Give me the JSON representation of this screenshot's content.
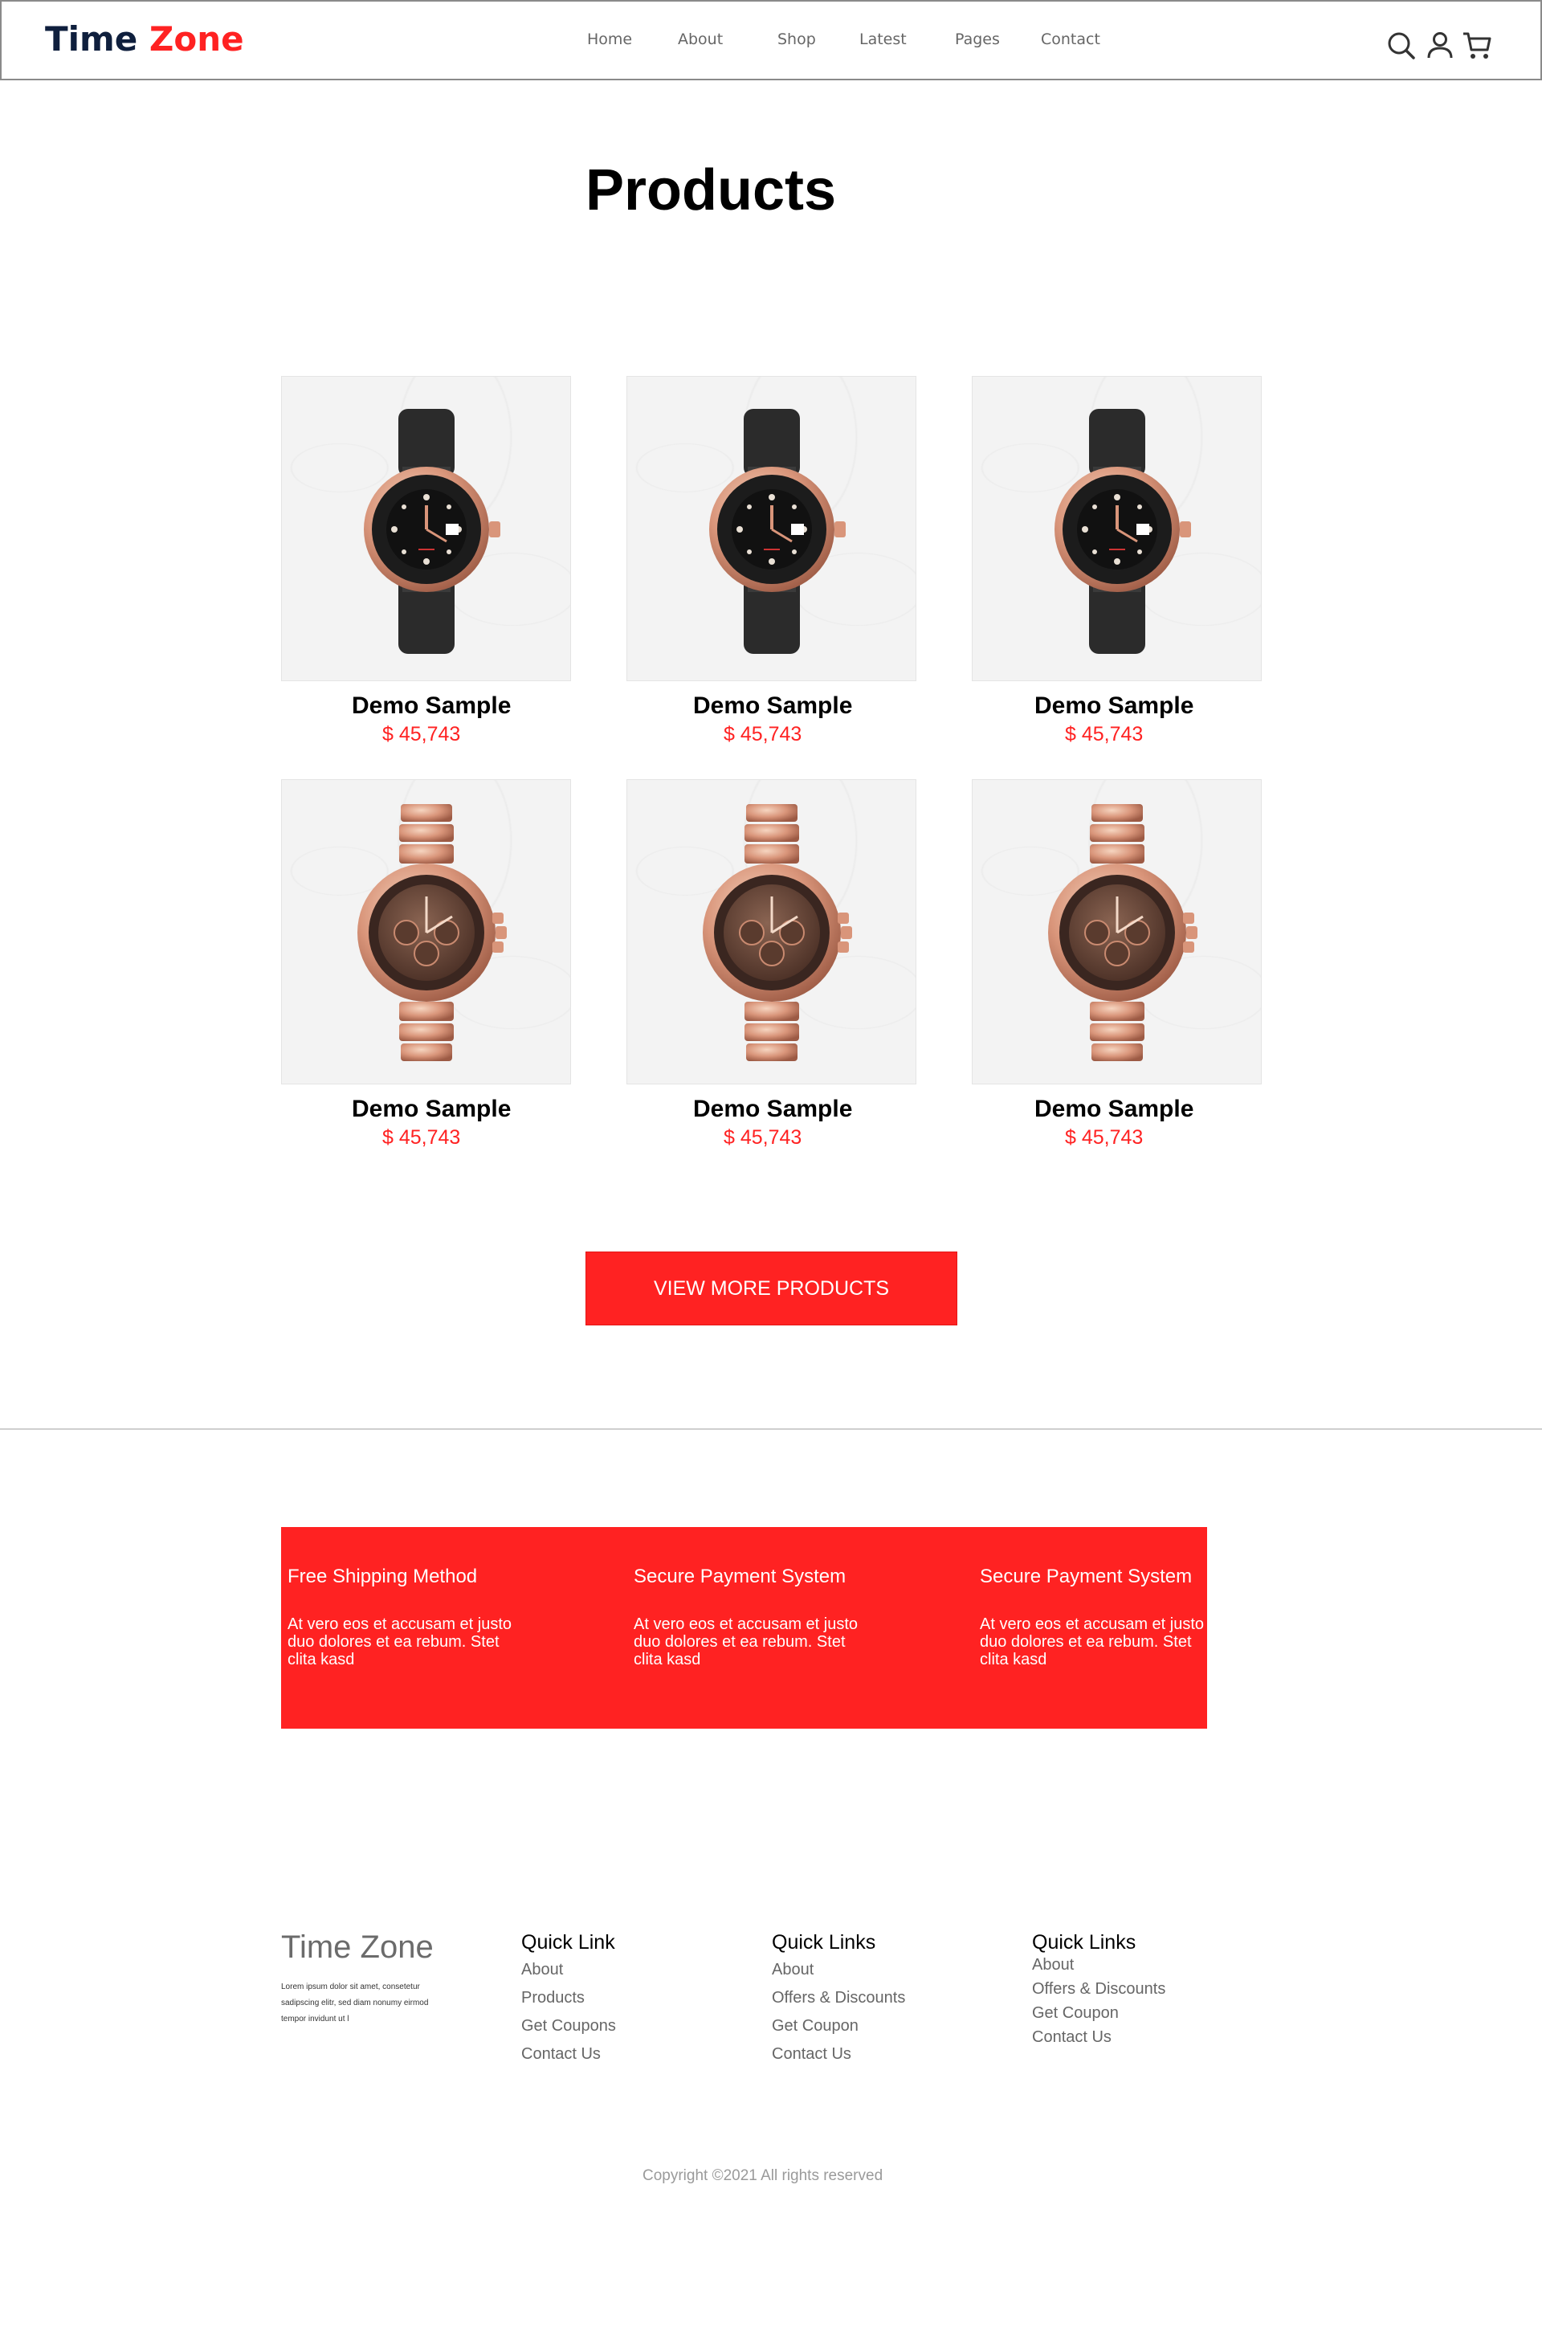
{
  "header": {
    "logo_part1": "Time",
    "logo_part2": "Zone",
    "nav": [
      "Home",
      "About",
      "Shop",
      "Latest",
      "Pages",
      "Contact"
    ],
    "icons": [
      "search-icon",
      "user-icon",
      "cart-icon"
    ]
  },
  "page_title": "Products",
  "products": [
    {
      "name": "Demo Sample",
      "price": "$ 45,743",
      "image": "black-strap-watch"
    },
    {
      "name": "Demo Sample",
      "price": "$ 45,743",
      "image": "black-strap-watch"
    },
    {
      "name": "Demo Sample",
      "price": "$ 45,743",
      "image": "black-strap-watch"
    },
    {
      "name": "Demo Sample",
      "price": "$ 45,743",
      "image": "rose-gold-chronograph-watch"
    },
    {
      "name": "Demo Sample",
      "price": "$ 45,743",
      "image": "rose-gold-chronograph-watch"
    },
    {
      "name": "Demo Sample",
      "price": "$ 45,743",
      "image": "rose-gold-chronograph-watch"
    }
  ],
  "view_more_label": "VIEW MORE PRODUCTS",
  "features": [
    {
      "title": "Free Shipping Method",
      "text": " At vero eos et accusam et justo duo dolores et ea rebum. Stet clita kasd"
    },
    {
      "title": "Secure Payment System",
      "text": " At vero eos et accusam et justo duo dolores et ea rebum. Stet clita kasd"
    },
    {
      "title": "Secure Payment System",
      "text": " At vero eos et accusam et justo duo dolores et ea rebum. Stet clita kasd"
    }
  ],
  "footer": {
    "brand": "Time Zone",
    "description": "Lorem ipsum dolor sit amet, consetetur sadipscing elitr, sed diam nonumy eirmod tempor invidunt ut l",
    "columns": [
      {
        "title": "Quick Link",
        "links": [
          "About",
          "Products",
          "Get Coupons",
          "Contact Us"
        ]
      },
      {
        "title": "Quick Links",
        "links": [
          "About",
          "Offers & Discounts",
          "Get Coupon",
          "Contact Us"
        ]
      },
      {
        "title": "Quick Links",
        "links": [
          "About",
          "Offers & Discounts",
          "Get Coupon",
          "Contact Us"
        ]
      }
    ],
    "copyright": "Copyright ©2021 All rights reserved"
  },
  "colors": {
    "accent": "#ff2222",
    "logo_dark": "#0f1f3d"
  }
}
